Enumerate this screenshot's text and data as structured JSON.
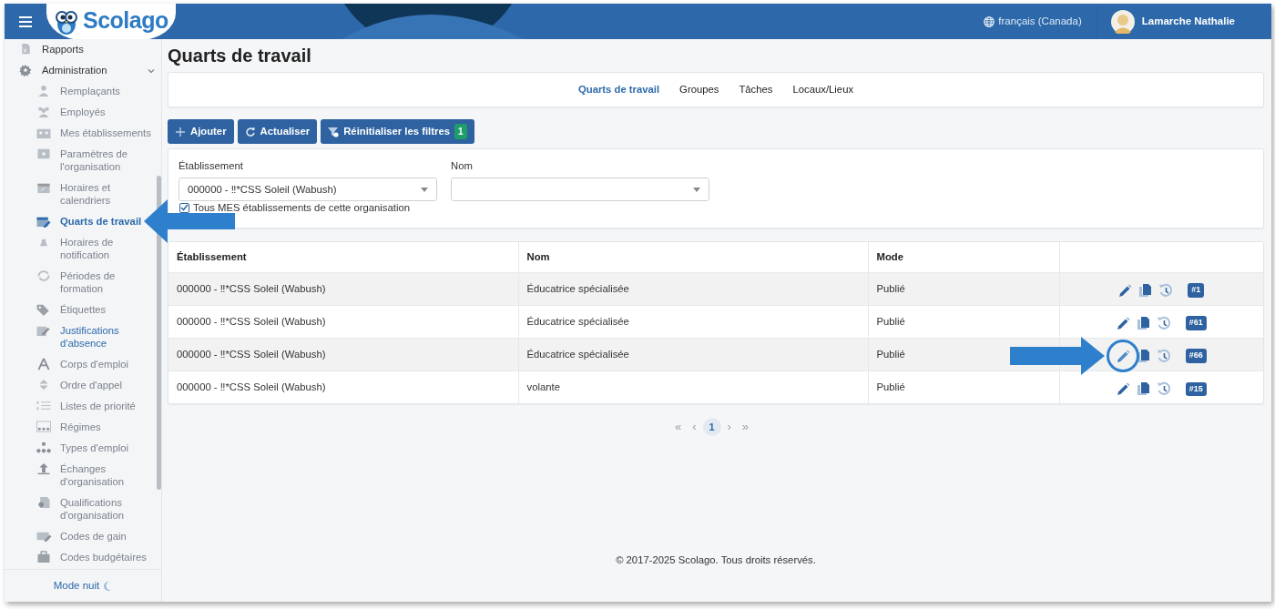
{
  "header": {
    "brand": "Scolago",
    "language": "français (Canada)",
    "user": "Lamarche Nathalie"
  },
  "sidebar": {
    "items": [
      {
        "label": "Rapports",
        "selected": false,
        "hovered": false
      },
      {
        "label": "Administration",
        "selected": false,
        "hovered": false,
        "expanded": true,
        "children": [
          {
            "label": "Remplaçants",
            "selected": false,
            "hovered": false
          },
          {
            "label": "Employés",
            "selected": false,
            "hovered": false
          },
          {
            "label": "Mes établissements",
            "selected": false,
            "hovered": false
          },
          {
            "label": "Paramètres de l'organisation",
            "selected": false,
            "hovered": false
          },
          {
            "label": "Horaires et calendriers",
            "selected": false,
            "hovered": false
          },
          {
            "label": "Quarts de travail",
            "selected": true,
            "hovered": false,
            "callout": true
          },
          {
            "label": "Horaires de notification",
            "selected": false,
            "hovered": false
          },
          {
            "label": "Périodes de formation",
            "selected": false,
            "hovered": false
          },
          {
            "label": "Étiquettes",
            "selected": false,
            "hovered": false
          },
          {
            "label": "Justifications d'absence",
            "selected": false,
            "hovered": true
          },
          {
            "label": "Corps d'emploi",
            "selected": false,
            "hovered": false
          },
          {
            "label": "Ordre d'appel",
            "selected": false,
            "hovered": false
          },
          {
            "label": "Listes de priorité",
            "selected": false,
            "hovered": false
          },
          {
            "label": "Régimes",
            "selected": false,
            "hovered": false
          },
          {
            "label": "Types d'emploi",
            "selected": false,
            "hovered": false
          },
          {
            "label": "Échanges d'organisation",
            "selected": false,
            "hovered": false
          },
          {
            "label": "Qualifications d'organisation",
            "selected": false,
            "hovered": false
          },
          {
            "label": "Codes de gain",
            "selected": false,
            "hovered": false
          },
          {
            "label": "Codes budgétaires",
            "selected": false,
            "hovered": false
          }
        ]
      }
    ],
    "footer": "Mode nuit"
  },
  "page": {
    "title": "Quarts de travail",
    "tabs": [
      {
        "label": "Quarts de travail",
        "selected": true
      },
      {
        "label": "Groupes",
        "selected": false
      },
      {
        "label": "Tâches",
        "selected": false
      },
      {
        "label": "Locaux/Lieux",
        "selected": false
      }
    ],
    "buttons": [
      {
        "label": "Ajouter",
        "kind": "add"
      },
      {
        "label": "Actualiser",
        "kind": "refresh"
      },
      {
        "label": "Réinitialiser les filtres",
        "kind": "reset",
        "badge": "1"
      }
    ],
    "filters": {
      "establishment": {
        "label": "Établissement",
        "value": "000000 - ‼*CSS Soleil (Wabush)"
      },
      "name": {
        "label": "Nom"
      },
      "checkbox": {
        "label": "Tous MES établissements de cette organisation",
        "checked": true
      }
    },
    "table": {
      "columns": [
        "Établissement",
        "Nom",
        "Mode"
      ],
      "rows": [
        {
          "establishment": "000000 - ‼*CSS Soleil (Wabush)",
          "name": "Éducatrice spécialisée",
          "mode": "Publié",
          "id": "#1",
          "callout": false
        },
        {
          "establishment": "000000 - ‼*CSS Soleil (Wabush)",
          "name": "Éducatrice spécialisée",
          "mode": "Publié",
          "id": "#61",
          "callout": false
        },
        {
          "establishment": "000000 - ‼*CSS Soleil (Wabush)",
          "name": "Éducatrice spécialisée",
          "mode": "Publié",
          "id": "#66",
          "callout": true
        },
        {
          "establishment": "000000 - ‼*CSS Soleil (Wabush)",
          "name": "volante",
          "mode": "Publié",
          "id": "#15",
          "callout": false
        }
      ]
    },
    "pagination": {
      "first": "«",
      "previous": "‹",
      "pages": [
        {
          "label": "1",
          "selected": true
        }
      ],
      "next": "›",
      "last": "»"
    },
    "footer": "© 2017-2025 Scolago. Tous droits réservés."
  }
}
